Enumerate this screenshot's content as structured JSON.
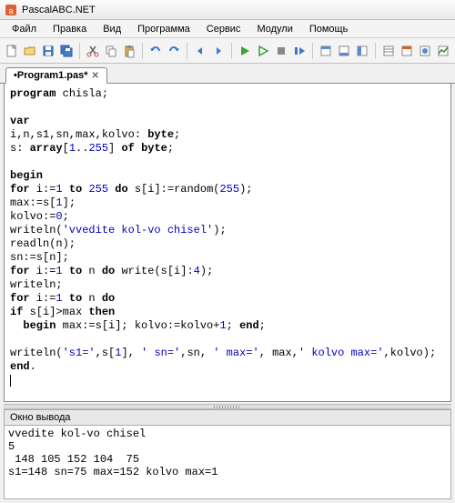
{
  "window": {
    "title": "PascalABC.NET"
  },
  "menu": [
    "Файл",
    "Правка",
    "Вид",
    "Программа",
    "Сервис",
    "Модули",
    "Помощь"
  ],
  "tab": {
    "label": "•Program1.pas*"
  },
  "code": {
    "l1_kw": "program",
    "l1_rest": " chisla;",
    "l3_kw": "var",
    "l4_a": "i,n,s1,sn,max,kolvo: ",
    "l4_kw": "byte",
    "l4_b": ";",
    "l5_a": "s: ",
    "l5_kw": "array",
    "l5_b": "[",
    "l5_n1": "1",
    "l5_c": "..",
    "l5_n2": "255",
    "l5_d": "] ",
    "l5_kw2": "of",
    "l5_e": " ",
    "l5_kw3": "byte",
    "l5_f": ";",
    "l7_kw": "begin",
    "l8_kw": "for",
    "l8_a": " i:=",
    "l8_n1": "1",
    "l8_b": " ",
    "l8_kw2": "to",
    "l8_c": " ",
    "l8_n2": "255",
    "l8_d": " ",
    "l8_kw3": "do",
    "l8_e": " s[i]:=random(",
    "l8_n3": "255",
    "l8_f": ");",
    "l9": "max:=s[",
    "l9_n": "1",
    "l9_b": "];",
    "l10": "kolvo:=",
    "l10_n": "0",
    "l10_b": ";",
    "l11_a": "writeln(",
    "l11_s": "'vvedite kol-vo chisel'",
    "l11_b": ");",
    "l12": "readln(n);",
    "l13": "sn:=s[n];",
    "l14_kw": "for",
    "l14_a": " i:=",
    "l14_n1": "1",
    "l14_b": " ",
    "l14_kw2": "to",
    "l14_c": " n ",
    "l14_kw3": "do",
    "l14_d": " write(s[i]:",
    "l14_n2": "4",
    "l14_e": ");",
    "l15": "writeln;",
    "l16_kw": "for",
    "l16_a": " i:=",
    "l16_n1": "1",
    "l16_b": " ",
    "l16_kw2": "to",
    "l16_c": " n ",
    "l16_kw3": "do",
    "l17_kw": "if",
    "l17_a": " s[i]>max ",
    "l17_kw2": "then",
    "l18_a": "  ",
    "l18_kw": "begin",
    "l18_b": " max:=s[i]; kolvo:=kolvo+",
    "l18_n": "1",
    "l18_c": "; ",
    "l18_kw2": "end",
    "l18_d": ";",
    "l20_a": "writeln(",
    "l20_s1": "'s1='",
    "l20_b": ",s[",
    "l20_n": "1",
    "l20_c": "], ",
    "l20_s2": "' sn='",
    "l20_d": ",sn, ",
    "l20_s3": "' max='",
    "l20_e": ", max,",
    "l20_s4": "' kolvo max='",
    "l20_f": ",kolvo);",
    "l21_kw": "end",
    "l21_a": "."
  },
  "output": {
    "title": "Окно вывода",
    "text": "vvedite kol-vo chisel\n5\n 148 105 152 104  75\ns1=148 sn=75 max=152 kolvo max=1"
  },
  "icons": {
    "new": "new-file-icon",
    "open": "open-icon",
    "save": "save-icon",
    "saveall": "save-all-icon",
    "cut": "cut-icon",
    "copy": "copy-icon",
    "paste": "paste-icon",
    "undo": "undo-icon",
    "redo": "redo-icon",
    "nav1": "nav-back-icon",
    "nav2": "nav-fwd-icon",
    "run": "run-icon",
    "step": "step-icon",
    "p1": "panel1-icon",
    "p2": "panel2-icon",
    "p3": "panel3-icon",
    "w1": "window1-icon",
    "w2": "window2-icon",
    "w3": "window3-icon",
    "w4": "window4-icon"
  }
}
